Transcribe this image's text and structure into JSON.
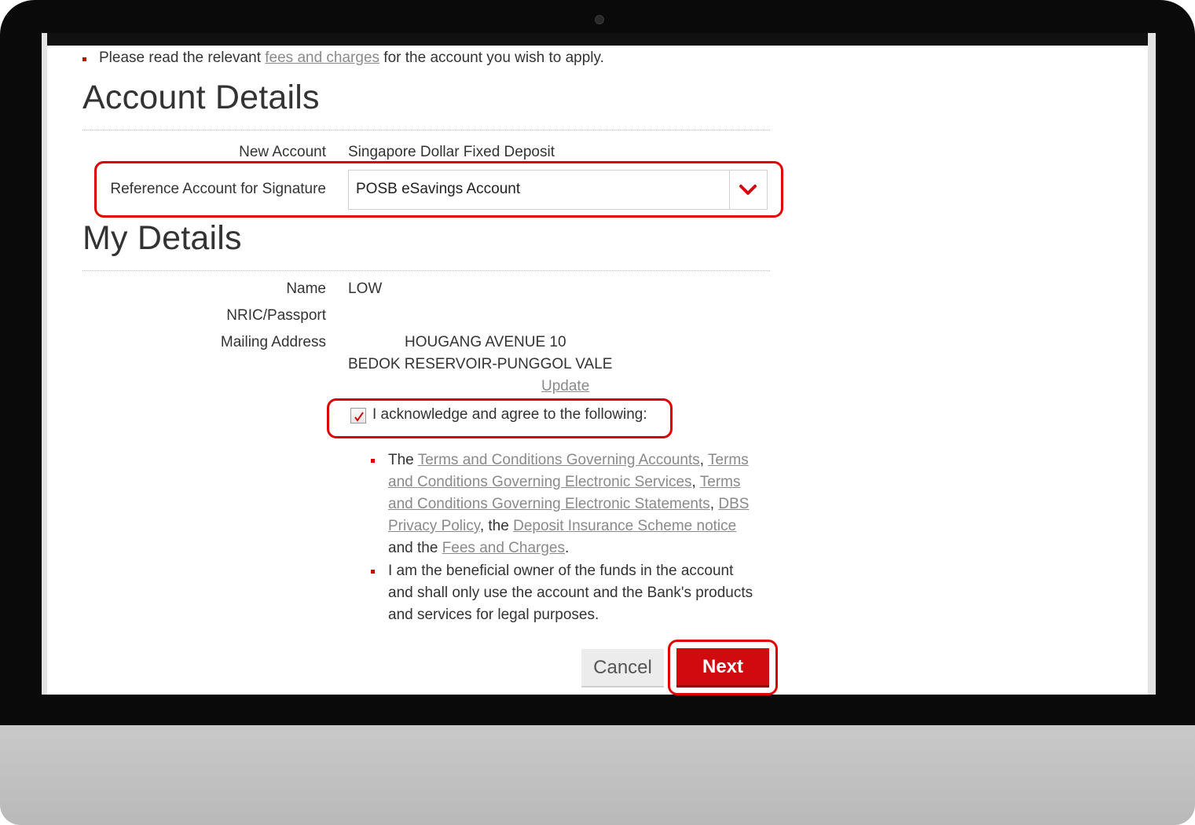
{
  "notice": {
    "prefix": "Please read the relevant",
    "link": "fees and charges",
    "suffix": "for the account you wish to apply."
  },
  "account_details": {
    "heading": "Account Details",
    "new_account_label": "New Account",
    "new_account_value": "Singapore Dollar Fixed Deposit",
    "ref_account_label": "Reference Account for Signature",
    "ref_account_value": "POSB eSavings Account"
  },
  "my_details": {
    "heading": "My Details",
    "name_label": "Name",
    "name_value": "LOW",
    "nric_label": "NRIC/Passport",
    "nric_value": "",
    "address_label": "Mailing Address",
    "address_line1": "HOUGANG AVENUE 10",
    "address_line2": "BEDOK RESERVOIR-PUNGGOL VALE",
    "update_link": "Update"
  },
  "acknowledge": {
    "checked": true,
    "label": "I acknowledge and agree to the following:"
  },
  "terms": {
    "item1": {
      "the": "The",
      "link1": "Terms and Conditions Governing Accounts",
      "link2": "Terms and Conditions Governing Electronic Services",
      "link3": "Terms and Conditions Governing Electronic Statements",
      "link4": "DBS Privacy Policy",
      "the2": "the",
      "link5": "Deposit Insurance Scheme notice",
      "and_the": "and the",
      "link6": "Fees and Charges"
    },
    "item2": "I am the beneficial owner of the funds in the account and shall only use the account and the Bank's products and services for legal purposes."
  },
  "actions": {
    "cancel": "Cancel",
    "next": "Next"
  },
  "colors": {
    "accent": "#d10a10",
    "highlight": "#e00000"
  },
  "icons": {
    "dropdown": "chevron-down-icon",
    "checkbox": "checkmark-icon"
  }
}
